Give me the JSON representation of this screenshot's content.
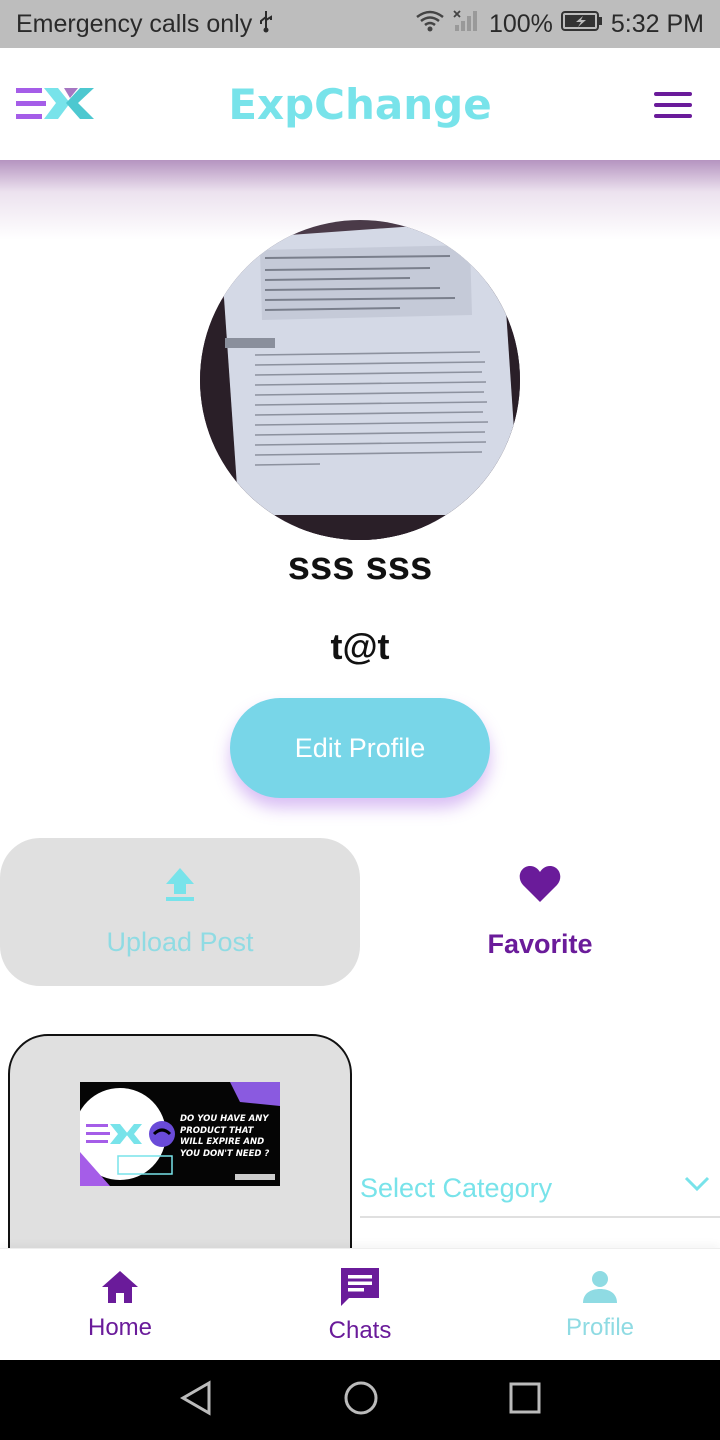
{
  "status_bar": {
    "carrier": "Emergency calls only",
    "battery": "100%",
    "time": "5:32 PM",
    "icons": [
      "usb-icon",
      "wifi-icon",
      "signal-icon",
      "battery-charging-icon"
    ]
  },
  "header": {
    "title": "ExpChange",
    "logo": "exchange-logo",
    "menu_icon": "hamburger-menu-icon"
  },
  "profile": {
    "name": "sss sss",
    "email": "t@t",
    "edit_button": "Edit Profile"
  },
  "tabs": [
    {
      "label": "Upload Post",
      "icon": "upload-icon",
      "selected": true
    },
    {
      "label": "Favorite",
      "icon": "heart-icon",
      "selected": false
    }
  ],
  "post": {
    "image_text": "DO YOU HAVE ANY PRODUCT THAT WILL EXPIRE AND YOU DON'T NEED ?"
  },
  "category_select": {
    "placeholder": "Select Category"
  },
  "bottom_nav": [
    {
      "label": "Home",
      "icon": "home-icon",
      "active": false
    },
    {
      "label": "Chats",
      "icon": "chat-icon",
      "active": false
    },
    {
      "label": "Profile",
      "icon": "person-icon",
      "active": true
    }
  ],
  "colors": {
    "accent_cyan": "#78e3ea",
    "accent_purple": "#6a1b9a",
    "button_cyan": "#78d6e8",
    "tab_bg": "#e0e0e0"
  }
}
